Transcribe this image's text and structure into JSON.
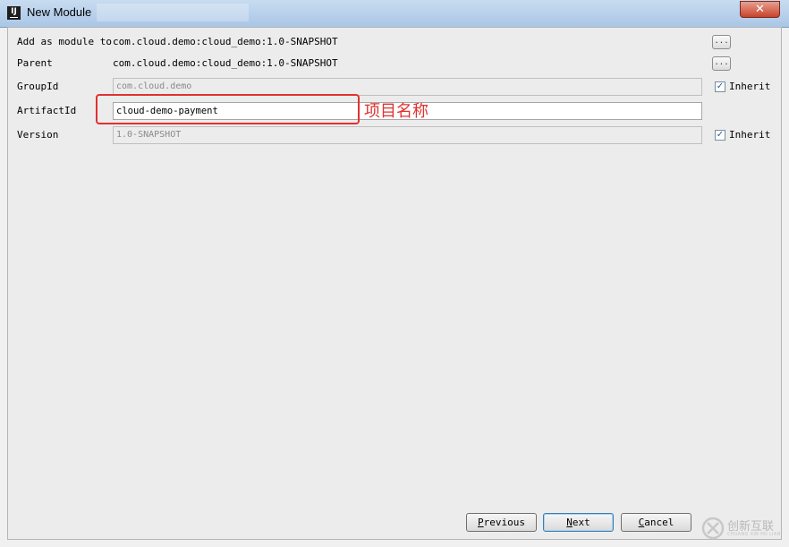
{
  "window": {
    "title": "New Module",
    "close_symbol": "✕"
  },
  "form": {
    "add_as_module": {
      "label": "Add as module to",
      "value": "com.cloud.demo:cloud_demo:1.0-SNAPSHOT",
      "button": "..."
    },
    "parent": {
      "label": "Parent",
      "value": "com.cloud.demo:cloud_demo:1.0-SNAPSHOT",
      "button": "..."
    },
    "group_id": {
      "label": "GroupId",
      "value": "com.cloud.demo",
      "inherit_label": "Inherit",
      "inherit_checked": true
    },
    "artifact_id": {
      "label": "ArtifactId",
      "value": "cloud-demo-payment"
    },
    "version": {
      "label": "Version",
      "value": "1.0-SNAPSHOT",
      "inherit_label": "Inherit",
      "inherit_checked": true
    }
  },
  "annotation": {
    "text": "项目名称",
    "color": "#e0322f"
  },
  "buttons": {
    "previous": "Previous",
    "next": "Next",
    "cancel": "Cancel"
  },
  "watermark": {
    "text": "创新互联",
    "sub": "CHUANG XIN HU LIAN"
  },
  "icons": {
    "app": "intellij-idea-icon",
    "checkbox": "checkmark-icon",
    "close": "close-icon"
  }
}
